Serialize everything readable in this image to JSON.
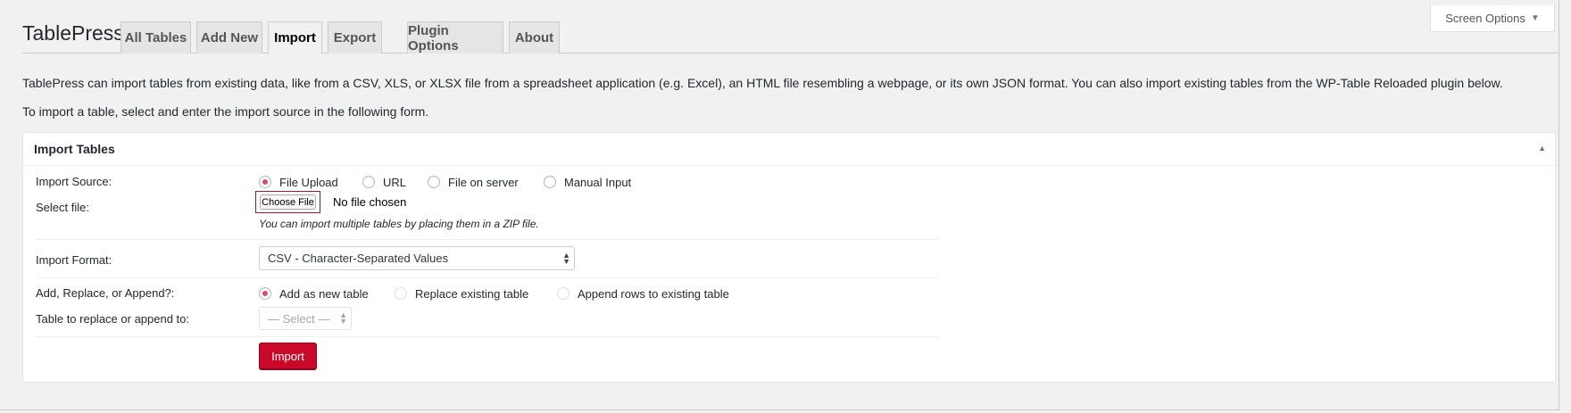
{
  "app": {
    "title": "TablePress"
  },
  "screen_options": {
    "label": "Screen Options",
    "caret": "▼"
  },
  "tabs": [
    {
      "label": "All Tables"
    },
    {
      "label": "Add New"
    },
    {
      "label": "Import",
      "active": true
    },
    {
      "label": "Export"
    },
    {
      "label": "Plugin Options"
    },
    {
      "label": "About"
    }
  ],
  "intro": {
    "line1": "TablePress can import tables from existing data, like from a CSV, XLS, or XLSX file from a spreadsheet application (e.g. Excel), an HTML file resembling a webpage, or its own JSON format. You can also import existing tables from the WP-Table Reloaded plugin below.",
    "line2": "To import a table, select and enter the import source in the following form."
  },
  "panel": {
    "title": "Import Tables",
    "toggle": "▲",
    "import_source": {
      "label": "Import Source:",
      "options": [
        "File Upload",
        "URL",
        "File on server",
        "Manual Input"
      ],
      "selected": "File Upload"
    },
    "select_file": {
      "label": "Select file:",
      "button": "Choose File",
      "status": "No file chosen",
      "hint": "You can import multiple tables by placing them in a ZIP file."
    },
    "import_format": {
      "label": "Import Format:",
      "value": "CSV - Character-Separated Values"
    },
    "add_replace": {
      "label": "Add, Replace, or Append?:",
      "options": [
        "Add as new table",
        "Replace existing table",
        "Append rows to existing table"
      ],
      "selected": "Add as new table"
    },
    "table_to_replace": {
      "label": "Table to replace or append to:",
      "value": "— Select —"
    },
    "submit": "Import"
  },
  "colors": {
    "accent": "#c9082a",
    "radio_dot": "#d64e6d"
  }
}
